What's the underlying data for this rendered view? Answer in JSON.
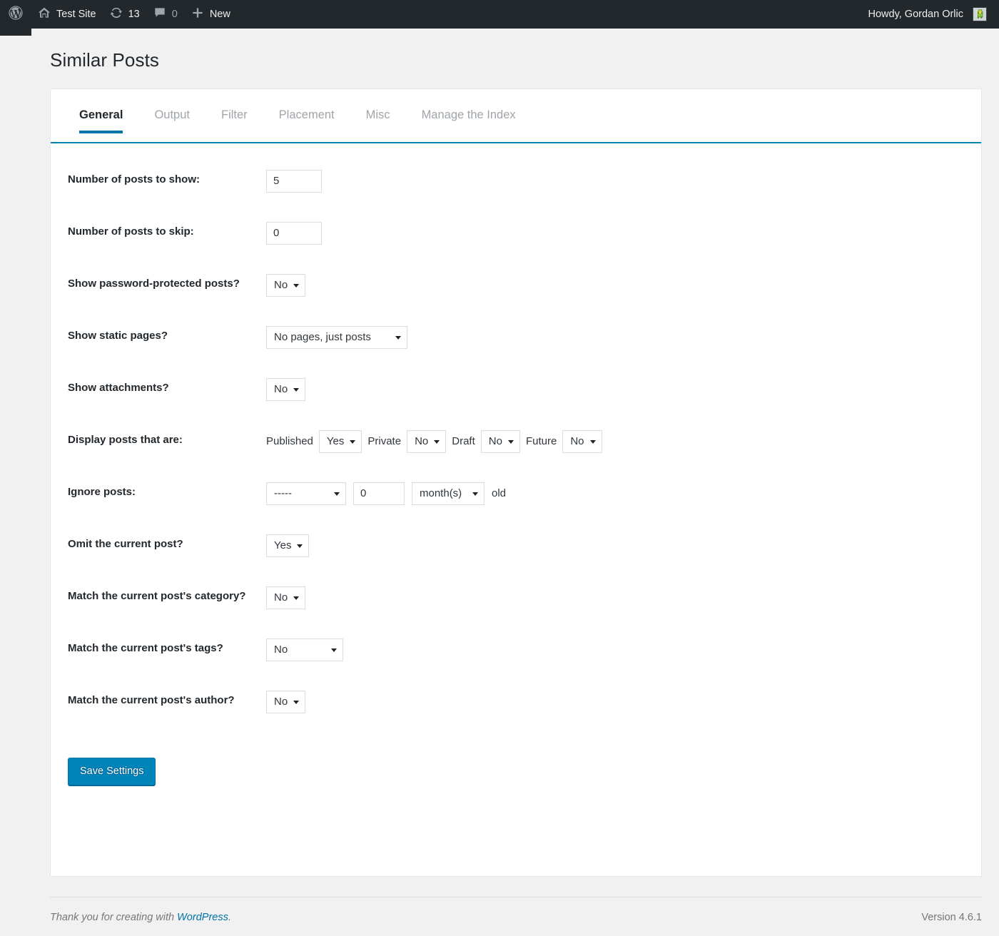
{
  "adminbar": {
    "wp_logo": "wordpress-logo",
    "site_name": "Test Site",
    "updates_count": "13",
    "comments_count": "0",
    "new_label": "New",
    "howdy": "Howdy, Gordan Orlic"
  },
  "page": {
    "title": "Similar Posts"
  },
  "tabs": [
    {
      "label": "General",
      "active": true
    },
    {
      "label": "Output",
      "active": false
    },
    {
      "label": "Filter",
      "active": false
    },
    {
      "label": "Placement",
      "active": false
    },
    {
      "label": "Misc",
      "active": false
    },
    {
      "label": "Manage the Index",
      "active": false
    }
  ],
  "form": {
    "posts_to_show": {
      "label": "Number of posts to show:",
      "value": "5"
    },
    "posts_to_skip": {
      "label": "Number of posts to skip:",
      "value": "0"
    },
    "password_protected": {
      "label": "Show password-protected posts?",
      "value": "No"
    },
    "static_pages": {
      "label": "Show static pages?",
      "value": "No pages, just posts"
    },
    "attachments": {
      "label": "Show attachments?",
      "value": "No"
    },
    "display_status": {
      "label": "Display posts that are:",
      "published_label": "Published",
      "published_value": "Yes",
      "private_label": "Private",
      "private_value": "No",
      "draft_label": "Draft",
      "draft_value": "No",
      "future_label": "Future",
      "future_value": "No"
    },
    "ignore_posts": {
      "label": "Ignore posts:",
      "comparator": "-----",
      "amount": "0",
      "unit": "month(s)",
      "suffix": "old"
    },
    "omit_current": {
      "label": "Omit the current post?",
      "value": "Yes"
    },
    "match_category": {
      "label": "Match the current post's category?",
      "value": "No"
    },
    "match_tags": {
      "label": "Match the current post's tags?",
      "value": "No"
    },
    "match_author": {
      "label": "Match the current post's author?",
      "value": "No"
    },
    "save_label": "Save Settings"
  },
  "footer": {
    "thanks_prefix": "Thank you for creating with ",
    "wordpress_link": "WordPress",
    "thanks_suffix": ".",
    "version": "Version 4.6.1"
  },
  "colors": {
    "adminbar_bg": "#23282d",
    "accent_blue": "#0073aa",
    "button_blue": "#0085ba",
    "page_bg": "#f1f1f1"
  }
}
